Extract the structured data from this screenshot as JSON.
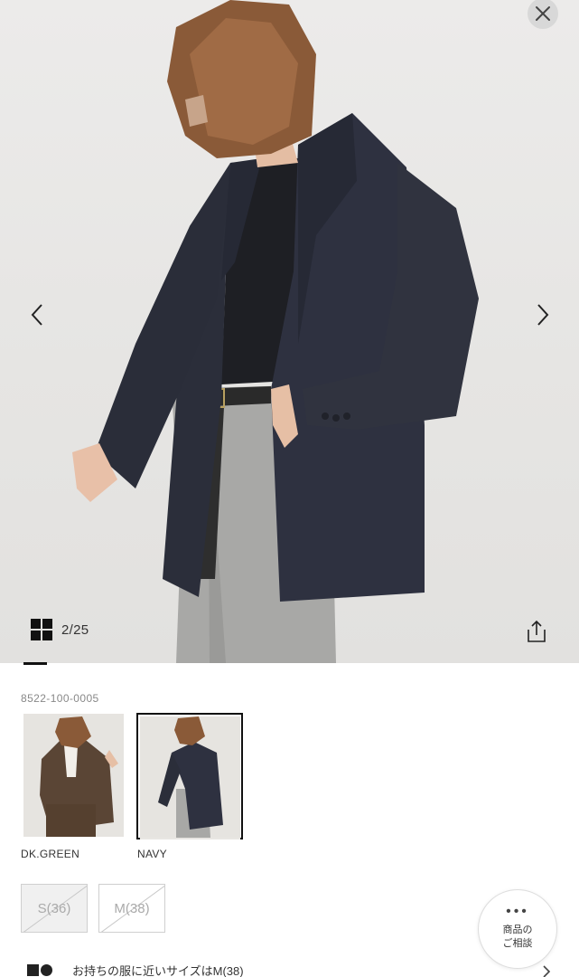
{
  "gallery": {
    "counter": "2/25",
    "image_description_icon": "grid-view-icon"
  },
  "product": {
    "sku": "8522-100-0005"
  },
  "colors": [
    {
      "label": "DK.GREEN",
      "selected": false,
      "swatch_color": "#5a4535"
    },
    {
      "label": "NAVY",
      "selected": true,
      "swatch_color": "#252a38"
    }
  ],
  "sizes": [
    {
      "label": "S(36)",
      "available": false
    },
    {
      "label": "M(38)",
      "available": false
    }
  ],
  "consult": {
    "dots": "•••",
    "line1": "商品の",
    "line2": "ご相談"
  },
  "size_hint": {
    "text": "お持ちの服に近いサイズはM(38)"
  },
  "theme": {
    "accent": "#111111",
    "muted": "#888888"
  }
}
